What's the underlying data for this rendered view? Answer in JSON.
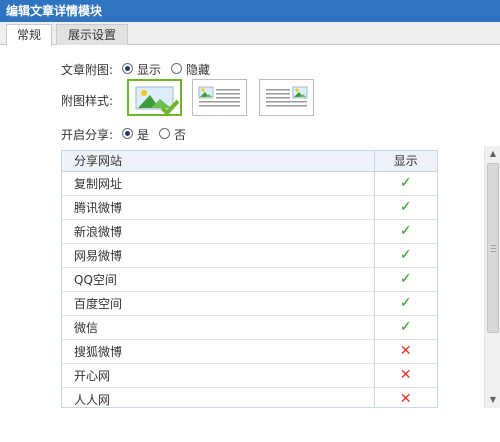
{
  "window": {
    "title": "编辑文章详情模块"
  },
  "tabs": [
    {
      "label": "常规",
      "active": true
    },
    {
      "label": "展示设置",
      "active": false
    }
  ],
  "form": {
    "image_label": "文章附图:",
    "image_options": [
      {
        "label": "显示",
        "checked": true
      },
      {
        "label": "隐藏",
        "checked": false
      }
    ],
    "style_label": "附图样式:",
    "style_options": [
      {
        "icon": "image-only-style-icon",
        "selected": true
      },
      {
        "icon": "image-left-text-style-icon",
        "selected": false
      },
      {
        "icon": "image-right-text-style-icon",
        "selected": false
      }
    ],
    "share_label": "开启分享:",
    "share_options": [
      {
        "label": "是",
        "checked": true
      },
      {
        "label": "否",
        "checked": false
      }
    ]
  },
  "share_table": {
    "columns": [
      "分享网站",
      "显示"
    ],
    "rows": [
      {
        "site": "复制网址",
        "show": true
      },
      {
        "site": "腾讯微博",
        "show": true
      },
      {
        "site": "新浪微博",
        "show": true
      },
      {
        "site": "网易微博",
        "show": true
      },
      {
        "site": "QQ空间",
        "show": true
      },
      {
        "site": "百度空间",
        "show": true
      },
      {
        "site": "微信",
        "show": true
      },
      {
        "site": "搜狐微博",
        "show": false
      },
      {
        "site": "开心网",
        "show": false
      },
      {
        "site": "人人网",
        "show": false
      }
    ]
  },
  "glyphs": {
    "check": "✓",
    "cross": "✕",
    "up": "▲",
    "down": "▼"
  },
  "colors": {
    "title_bar": "#2f74c1",
    "selected_border": "#6eb52b",
    "check": "#2c9a13",
    "cross": "#d8322b"
  }
}
